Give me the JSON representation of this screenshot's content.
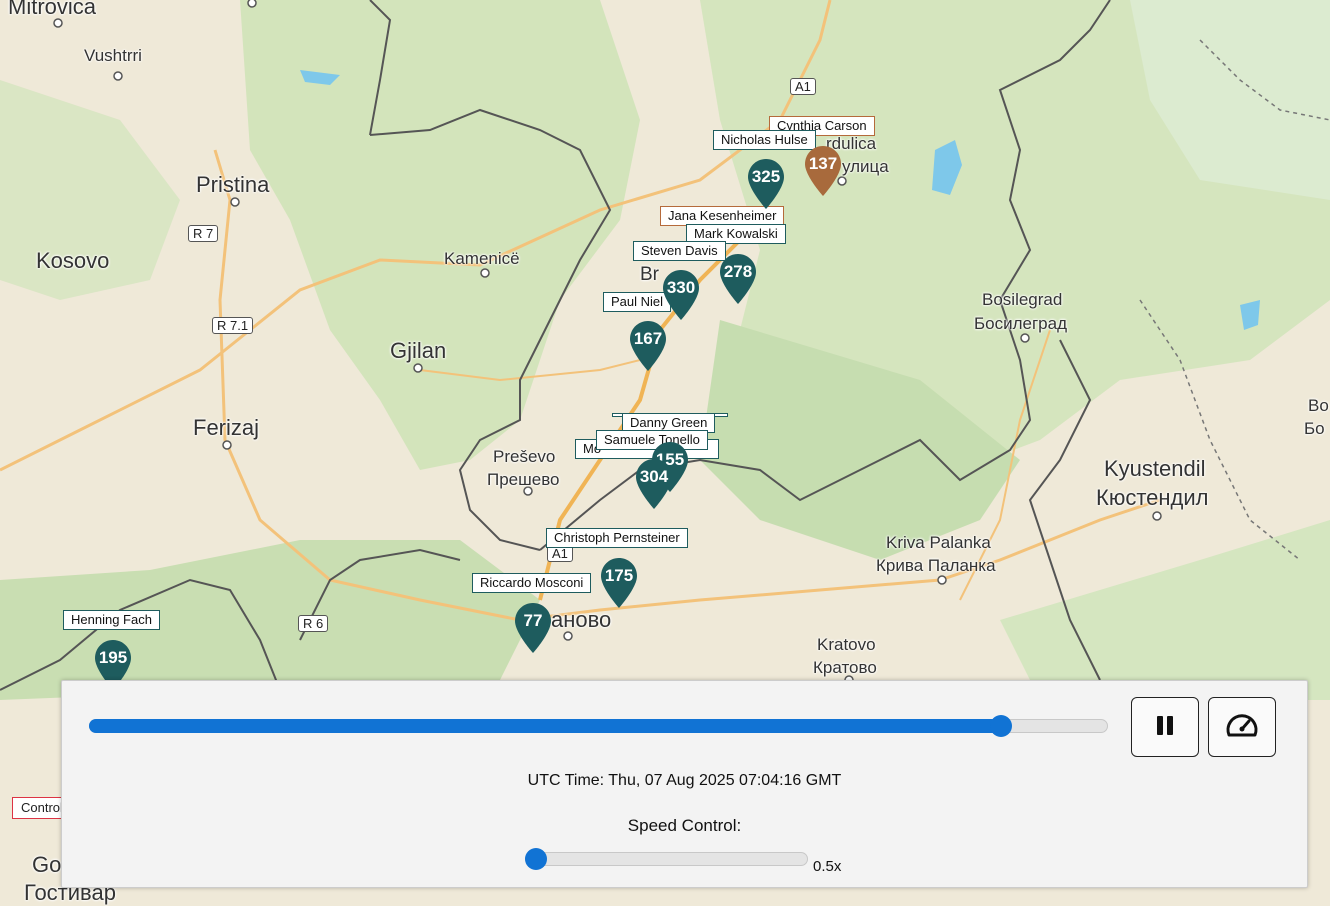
{
  "map": {
    "places": [
      {
        "id": "mitrovica",
        "label": "Mitrovica"
      },
      {
        "id": "vushtrri",
        "label": "Vushtrri"
      },
      {
        "id": "pristina",
        "label": "Pristina"
      },
      {
        "id": "kosovo",
        "label": "Kosovo"
      },
      {
        "id": "kamenice",
        "label": "Kamenicë"
      },
      {
        "id": "gjilan",
        "label": "Gjilan"
      },
      {
        "id": "ferizaj",
        "label": "Ferizaj"
      },
      {
        "id": "presevo",
        "label": "Preševo"
      },
      {
        "id": "presevo_cyr",
        "label": "Прешево"
      },
      {
        "id": "surdulica_part",
        "label": "rdulica"
      },
      {
        "id": "surdulica_cyr_part",
        "label": "улица"
      },
      {
        "id": "vranje_part",
        "label": "Br"
      },
      {
        "id": "bosilegrad",
        "label": "Bosilegrad"
      },
      {
        "id": "bosilegrad_cyr",
        "label": "Босилеград"
      },
      {
        "id": "kyustendil",
        "label": "Kyustendil"
      },
      {
        "id": "kyustendil_cyr",
        "label": "Кюстендил"
      },
      {
        "id": "kriva_palanka",
        "label": "Kriva Palanka"
      },
      {
        "id": "kriva_palanka_cyr",
        "label": "Крива Паланка"
      },
      {
        "id": "kumanovo_part",
        "label": "аново"
      },
      {
        "id": "kratovo",
        "label": "Kratovo"
      },
      {
        "id": "kratovo_cyr",
        "label": "Кратово"
      },
      {
        "id": "gostivar_part",
        "label": "Go"
      },
      {
        "id": "gostivar_cyr_part",
        "label": "Гостивар"
      },
      {
        "id": "bo_right",
        "label": "Bo"
      },
      {
        "id": "bo_right_cyr",
        "label": "Бо"
      }
    ],
    "roads": [
      "A1",
      "R 7",
      "R 7.1",
      "R 6",
      "A1"
    ],
    "markers": [
      {
        "id": "m137",
        "value": "137",
        "color": "#a86a3c"
      },
      {
        "id": "m325",
        "value": "325",
        "color": "#1e5c5e"
      },
      {
        "id": "m278",
        "value": "278",
        "color": "#1e5c5e"
      },
      {
        "id": "m330",
        "value": "330",
        "color": "#1e5c5e"
      },
      {
        "id": "m167",
        "value": "167",
        "color": "#1e5c5e"
      },
      {
        "id": "m155",
        "value": "155",
        "color": "#1e5c5e"
      },
      {
        "id": "m304",
        "value": "304",
        "color": "#1e5c5e"
      },
      {
        "id": "m175",
        "value": "175",
        "color": "#1e5c5e"
      },
      {
        "id": "m77",
        "value": "77",
        "color": "#1e5c5e"
      },
      {
        "id": "m195",
        "value": "195",
        "color": "#1e5c5e"
      }
    ],
    "name_tags": [
      {
        "id": "cynthia",
        "label": "Cynthia Carson"
      },
      {
        "id": "nicholas",
        "label": "Nicholas Hulse"
      },
      {
        "id": "jana",
        "label": "Jana Kesenheimer"
      },
      {
        "id": "mark",
        "label": "Mark Kowalski"
      },
      {
        "id": "steven",
        "label": "Steven Davis"
      },
      {
        "id": "paul",
        "label": "Paul Niel"
      },
      {
        "id": "danny",
        "label": "Danny Green"
      },
      {
        "id": "samuele",
        "label": "Samuele Tonello"
      },
      {
        "id": "mo",
        "label": "Mo"
      },
      {
        "id": "christoph",
        "label": "Christoph Pernsteiner"
      },
      {
        "id": "riccardo",
        "label": "Riccardo Mosconi"
      },
      {
        "id": "henning",
        "label": "Henning Fach"
      }
    ],
    "control_tag": "Control"
  },
  "panel": {
    "timeline_progress": 0.895,
    "utc_time": "UTC Time: Thu, 07 Aug 2025 07:04:16 GMT",
    "speed_label": "Speed Control:",
    "speed_progress": 0.0,
    "speed_value": "0.5x",
    "pause_icon": "pause-icon",
    "speedometer_icon": "speedometer-icon"
  }
}
